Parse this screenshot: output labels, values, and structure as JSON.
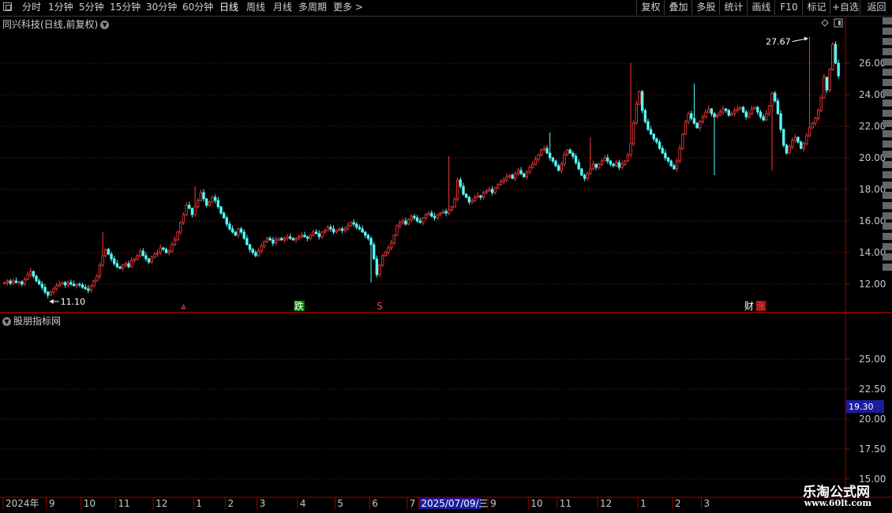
{
  "toolbar": {
    "timeframes": [
      "分时",
      "1分钟",
      "5分钟",
      "15分钟",
      "30分钟",
      "60分钟",
      "日线",
      "周线",
      "月线",
      "多周期",
      "更多 >"
    ],
    "active_timeframe": "日线",
    "buttons": [
      "复权",
      "叠加",
      "多股",
      "统计",
      "画线",
      "F10",
      "+自选",
      "返回"
    ]
  },
  "main_panel": {
    "title": "同兴科技(日线,前复权)"
  },
  "sub_panel": {
    "title": "股朋指标网",
    "current_value": "19.30"
  },
  "watermark": {
    "line1": "乐淘公式网",
    "line2": "www.60lt.com"
  },
  "colors": {
    "up": "#ff3c3c",
    "down": "#54fcfc",
    "grid": "#7a1a1a",
    "frame": "#a00000",
    "axis_text": "#c8c8c8",
    "highlight": "#1c1c9c"
  },
  "chart_data": {
    "type": "candlestick",
    "price_axis": {
      "ticks": [
        12.0,
        14.0,
        16.0,
        18.0,
        20.0,
        22.0,
        24.0,
        26.0
      ],
      "range": [
        10.4,
        28.2
      ]
    },
    "sub_axis": {
      "ticks": [
        15.0,
        17.5,
        20.0,
        22.5,
        25.0
      ],
      "range": [
        13.6,
        28.5
      ]
    },
    "annotations": {
      "high_label": "27.67",
      "low_label": "11.10"
    },
    "markers": [
      {
        "label": "⩓",
        "index": 62,
        "kind": "up"
      },
      {
        "label": "跌",
        "index": 102,
        "kind": "fall"
      },
      {
        "label": "S",
        "index": 130,
        "kind": "sell"
      },
      {
        "label": "财",
        "index": 258,
        "kind": "fin"
      },
      {
        "label": "涨",
        "index": 262,
        "kind": "rise"
      }
    ],
    "x_labels": [
      {
        "text": "2024年",
        "index": 0
      },
      {
        "text": "9",
        "index": 15
      },
      {
        "text": "10",
        "index": 27
      },
      {
        "text": "11",
        "index": 39
      },
      {
        "text": "12",
        "index": 52
      },
      {
        "text": "1",
        "index": 66
      },
      {
        "text": "2",
        "index": 77
      },
      {
        "text": "3",
        "index": 88
      },
      {
        "text": "4",
        "index": 102
      },
      {
        "text": "5",
        "index": 115
      },
      {
        "text": "6",
        "index": 127
      },
      {
        "text": "7",
        "index": 140
      },
      {
        "text": "2025/07/09/三",
        "index": 144
      },
      {
        "text": "9",
        "index": 168
      },
      {
        "text": "10",
        "index": 182
      },
      {
        "text": "11",
        "index": 192
      },
      {
        "text": "12",
        "index": 206
      },
      {
        "text": "1",
        "index": 220
      },
      {
        "text": "2",
        "index": 232
      },
      {
        "text": "3",
        "index": 242
      }
    ],
    "close": [
      12.1,
      12.2,
      12.05,
      12.2,
      12.1,
      12.15,
      12.0,
      12.3,
      12.6,
      12.8,
      12.5,
      12.2,
      12.0,
      11.8,
      11.5,
      11.3,
      11.5,
      11.7,
      11.9,
      12.0,
      12.1,
      11.95,
      12.1,
      12.0,
      11.9,
      12.0,
      11.95,
      11.8,
      11.7,
      11.6,
      11.9,
      12.2,
      12.5,
      13.2,
      13.8,
      14.2,
      13.9,
      13.6,
      13.3,
      13.1,
      13.0,
      13.2,
      13.3,
      13.1,
      13.5,
      13.6,
      13.8,
      14.1,
      13.8,
      13.6,
      13.4,
      13.7,
      13.9,
      14.0,
      14.3,
      14.2,
      14.0,
      14.1,
      14.5,
      14.8,
      15.3,
      15.9,
      16.4,
      17.0,
      16.8,
      16.4,
      16.9,
      17.3,
      17.8,
      17.4,
      17.0,
      17.2,
      17.5,
      17.3,
      16.9,
      16.5,
      16.2,
      15.8,
      15.5,
      15.3,
      15.1,
      15.5,
      15.3,
      14.9,
      14.5,
      14.2,
      14.0,
      13.8,
      14.1,
      14.4,
      14.7,
      14.9,
      14.8,
      14.6,
      14.8,
      14.9,
      14.8,
      14.9,
      15.0,
      14.9,
      14.8,
      14.9,
      15.0,
      15.1,
      15.0,
      14.9,
      15.1,
      15.3,
      15.2,
      15.0,
      15.3,
      15.4,
      15.6,
      15.5,
      15.3,
      15.4,
      15.5,
      15.4,
      15.5,
      15.7,
      15.9,
      15.8,
      15.6,
      15.5,
      15.3,
      15.1,
      14.9,
      14.5,
      13.6,
      12.6,
      13.2,
      13.8,
      14.0,
      14.3,
      14.6,
      15.1,
      15.7,
      15.9,
      16.0,
      15.8,
      16.1,
      16.3,
      16.2,
      16.0,
      15.9,
      16.2,
      16.4,
      16.5,
      16.3,
      16.2,
      16.4,
      16.5,
      16.6,
      16.5,
      16.7,
      16.9,
      17.4,
      18.6,
      18.2,
      17.7,
      17.5,
      17.2,
      17.3,
      17.5,
      17.6,
      17.5,
      17.8,
      17.9,
      18.0,
      17.8,
      18.1,
      18.3,
      18.5,
      18.6,
      18.8,
      18.9,
      18.7,
      19.0,
      19.2,
      19.0,
      18.8,
      19.1,
      19.4,
      19.6,
      19.9,
      20.2,
      20.5,
      20.6,
      20.3,
      20.0,
      19.8,
      19.5,
      19.2,
      19.6,
      20.2,
      20.5,
      20.3,
      20.1,
      19.7,
      19.3,
      18.9,
      18.7,
      19.0,
      19.3,
      19.6,
      19.4,
      19.6,
      19.8,
      20.0,
      19.8,
      19.6,
      19.5,
      19.7,
      19.4,
      19.6,
      19.8,
      20.2,
      20.9,
      22.2,
      23.4,
      24.2,
      23.0,
      22.3,
      21.8,
      21.5,
      21.2,
      21.0,
      20.6,
      20.3,
      20.0,
      19.8,
      19.5,
      19.3,
      19.8,
      20.6,
      21.5,
      22.3,
      22.8,
      22.5,
      22.2,
      21.9,
      22.3,
      22.6,
      22.9,
      23.1,
      22.8,
      22.6,
      22.7,
      22.9,
      23.1,
      23.0,
      22.7,
      22.8,
      23.0,
      23.1,
      23.2,
      22.9,
      22.6,
      22.8,
      23.1,
      23.2,
      22.9,
      22.6,
      22.4,
      22.8,
      23.3,
      24.1,
      23.6,
      22.8,
      21.8,
      20.8,
      20.3,
      20.7,
      21.1,
      21.3,
      21.0,
      20.6,
      20.9,
      21.4,
      21.9,
      22.2,
      22.5,
      23.0,
      23.8,
      25.1,
      24.3,
      25.6,
      27.2,
      26.0,
      25.2
    ],
    "highs": {
      "34": 15.3,
      "66": 18.2,
      "121": 16.1,
      "154": 20.1,
      "189": 21.6,
      "203": 21.3,
      "217": 26.0,
      "239": 24.7,
      "279": 27.67
    },
    "lows": {
      "15": 11.1,
      "127": 12.1,
      "246": 18.9,
      "266": 19.2
    }
  }
}
